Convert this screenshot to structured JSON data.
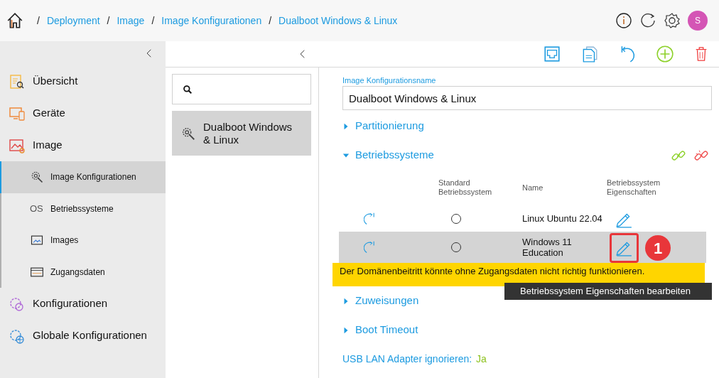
{
  "breadcrumb": [
    {
      "separator": "/",
      "label": "Deployment"
    },
    {
      "separator": "/",
      "label": "Image"
    },
    {
      "separator": "/",
      "label": "Image Konfigurationen"
    },
    {
      "separator": "/",
      "label": "Dualboot Windows & Linux"
    }
  ],
  "user": {
    "initial": "S"
  },
  "sidebar": {
    "items": [
      {
        "label": "Übersicht",
        "selected": false
      },
      {
        "label": "Geräte",
        "selected": false
      },
      {
        "label": "Image",
        "selected": false,
        "children": [
          {
            "label": "Image Konfigurationen",
            "selected": true
          },
          {
            "label": "Betriebssysteme",
            "glyph": "OS",
            "selected": false
          },
          {
            "label": "Images",
            "selected": false
          },
          {
            "label": "Zugangsdaten",
            "selected": false
          }
        ]
      },
      {
        "label": "Konfigurationen",
        "selected": false
      },
      {
        "label": "Globale Konfigurationen",
        "selected": false
      }
    ]
  },
  "list": {
    "items": [
      {
        "label": "Dualboot Windows & Linux",
        "selected": true
      }
    ]
  },
  "form": {
    "label": "Image Konfigurationsname",
    "value": "Dualboot Windows & Linux"
  },
  "sections": [
    {
      "title": "Partitionierung",
      "expanded": false
    },
    {
      "title": "Betriebssysteme",
      "expanded": true,
      "columns": [
        "Standard Betriebssystem",
        "Name",
        "Betriebssystem Eigenschaften"
      ],
      "rows": [
        {
          "default": false,
          "name": "Linux Ubuntu 22.04",
          "highlighted": false,
          "marked": false
        },
        {
          "default": false,
          "name": "Windows 11 Education",
          "highlighted": true,
          "marked": true
        }
      ]
    },
    {
      "title": "Zuweisungen",
      "expanded": false
    },
    {
      "title": "Boot Timeout",
      "expanded": false
    }
  ],
  "warning": "Der Domänenbeitritt könnte ohne Zugangsdaten nicht richtig funktionieren.",
  "tooltip": "Betriebssystem Eigenschaften bearbeiten",
  "callout_badge": "1",
  "usb": {
    "label": "USB LAN Adapter ignorieren:",
    "value": "Ja"
  }
}
